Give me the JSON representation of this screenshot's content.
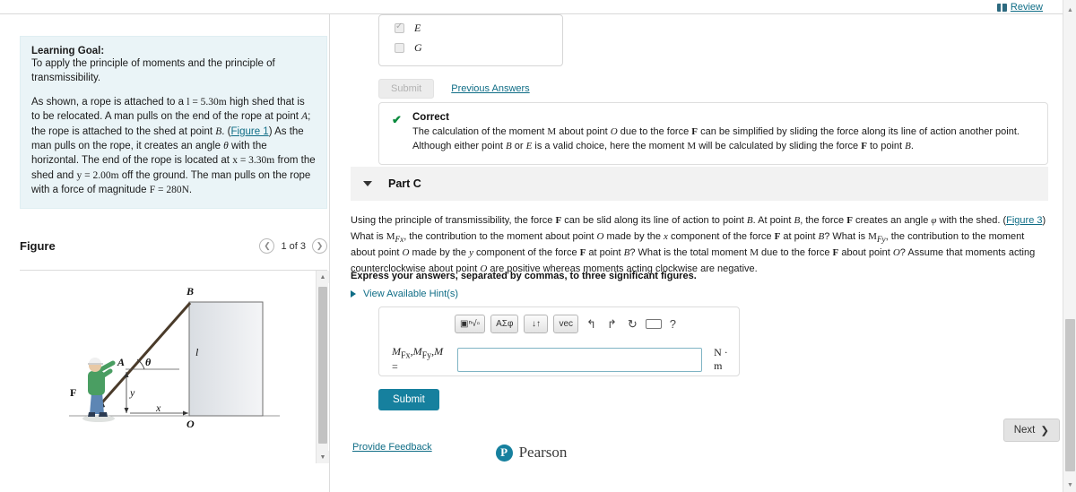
{
  "topbar": {
    "review_label": "Review",
    "book_icon": "book-icon"
  },
  "left": {
    "goal": {
      "title": "Learning Goal:",
      "subtitle": "To apply the principle of moments and the principle of transmissibility.",
      "body_1": "As shown, a rope is attached to a ",
      "l_value": "l = 5.30m",
      "body_2": " high shed that is to be relocated. A man pulls on the end of the rope at point ",
      "point_a": "A",
      "body_3": "; the rope is attached to the shed at point ",
      "point_b": "B",
      "body_4": ". (",
      "figure_link": "Figure 1",
      "body_5": ") As the man pulls on the rope, it creates an angle ",
      "theta": "θ",
      "body_6": " with the horizontal. The end of the rope is located at ",
      "x_value": "x = 3.30m",
      "body_7": " from the shed and ",
      "y_value": "y = 2.00m",
      "body_8": " off the ground. The man pulls on the rope with a force of magnitude ",
      "f_value": "F = 280N",
      "body_9": "."
    },
    "figure": {
      "title": "Figure",
      "prev_icon": "chevron-left-icon",
      "next_icon": "chevron-right-icon",
      "counter": "1 of 3",
      "labels": {
        "b": "B",
        "a": "A",
        "theta": "θ",
        "f": "F",
        "y": "y",
        "x": "x",
        "o": "O",
        "l": "l"
      }
    }
  },
  "main": {
    "prev_part": {
      "options": [
        {
          "label": "E",
          "checked": true
        },
        {
          "label": "G",
          "checked": false
        }
      ],
      "submit_label": "Submit",
      "previous_answers_label": "Previous Answers"
    },
    "correct": {
      "check_icon": "check-icon",
      "title": "Correct",
      "text_1": "The calculation of the moment ",
      "m1": "M",
      "text_2": " about point ",
      "o1": "O",
      "text_3": " due to the force ",
      "f1": "F",
      "text_4": " can be simplified by sliding the force along its line of action another point. Although either point ",
      "b1": "B",
      "text_5": " or ",
      "e1": "E",
      "text_6": " is a valid choice, here the moment ",
      "m2": "M",
      "text_7": " will be calculated by sliding the force ",
      "f2": "F",
      "text_8": " to point ",
      "b2": "B",
      "text_9": "."
    },
    "part_c": {
      "collapse_icon": "triangle-down-icon",
      "label": "Part C",
      "q_1": "Using the principle of transmissibility, the force ",
      "f1": "F",
      "q_2": " can be slid along its line of action to point ",
      "b1": "B",
      "q_3": ". At point ",
      "b2": "B",
      "q_4": ", the force ",
      "f2": "F",
      "q_5": " creates an angle ",
      "phi": "φ",
      "q_6": " with the shed. (",
      "figure_link": "Figure 3",
      "q_7": ") What is ",
      "mfx": "M",
      "mfx_sub": "Fx",
      "q_8": ", the contribution to the moment about point ",
      "o1": "O",
      "q_9": " made by the ",
      "xc": "x",
      "q_10": " component of the force ",
      "f3": "F",
      "q_11": " at point ",
      "b3": "B",
      "q_12": "? What is ",
      "mfy": "M",
      "mfy_sub": "Fy",
      "q_13": ", the contribution to the moment about point ",
      "o2": "O",
      "q_14": " made by the ",
      "yc": "y",
      "q_15": " component of the force ",
      "f4": "F",
      "q_16": " at point ",
      "b4": "B",
      "q_17": "? What is the total moment ",
      "m1": "M",
      "q_18": " due to the force ",
      "f5": "F",
      "q_19": " about point ",
      "o3": "O",
      "q_20": "? Assume that moments acting counterclockwise about point ",
      "o4": "O",
      "q_21": " are positive whereas moments acting clockwise are negative.",
      "instructions": "Express your answers, separated by commas, to three significant figures.",
      "hints_label": "View Available Hint(s)",
      "toolbar": [
        {
          "name": "template-icon",
          "label": "▣ⁿ√▫"
        },
        {
          "name": "greek-symbols-button",
          "label": "ΑΣφ"
        },
        {
          "name": "updown-arrows-button",
          "label": "↓↑"
        },
        {
          "name": "vector-button",
          "label": "vec"
        },
        {
          "name": "undo-icon",
          "label": "↰"
        },
        {
          "name": "redo-icon",
          "label": "↱"
        },
        {
          "name": "reset-icon",
          "label": "↻"
        },
        {
          "name": "keyboard-icon",
          "label": ""
        },
        {
          "name": "help-icon",
          "label": "?"
        }
      ],
      "answer_label_m": "M",
      "answer_sub_x": "Fx",
      "answer_sub_y": "Fy",
      "answer_label_full": "M",
      "answer_equals": "=",
      "answer_value": "",
      "answer_placeholder": "",
      "units": "N · m",
      "submit_label": "Submit"
    },
    "provide_feedback_label": "Provide Feedback",
    "next_label": "Next",
    "next_icon": "chevron-right-icon"
  },
  "footer": {
    "brand_mark": "P",
    "brand_name": "Pearson",
    "copyright": ""
  }
}
